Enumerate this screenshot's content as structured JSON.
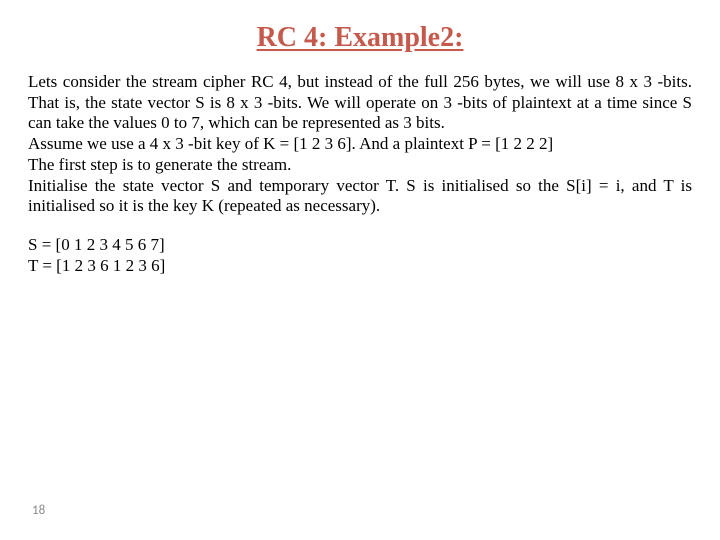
{
  "title": "RC 4: Example2:",
  "para1": " Lets consider the stream cipher RC 4, but instead of the full 256 bytes, we will use 8 x 3 -bits. That is, the state vector S is 8 x 3 -bits. We will operate on 3 -bits of plaintext at a time since S can take the values 0 to 7, which can be represented as 3 bits.",
  "para2": " Assume we use a 4 x 3 -bit key of K = [1 2 3 6]. And a plaintext P = [1 2 2 2]",
  "para3": "The first step is to generate the stream.",
  "para4": "Initialise the state vector S and temporary vector T. S is initialised so the S[i] = i, and T is initialised so it is the key K (repeated as necessary).",
  "code1": " S = [0 1 2 3 4 5 6 7]",
  "code2": "T = [1 2 3 6 1 2 3 6]",
  "pageNumber": "18"
}
